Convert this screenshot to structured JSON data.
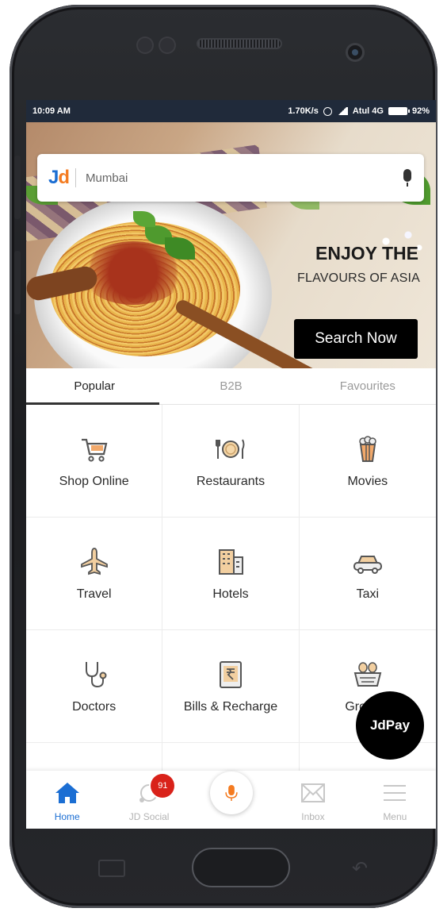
{
  "status_bar": {
    "time": "10:09 AM",
    "speed": "1.70K/s",
    "carrier": "Atul 4G",
    "battery": "92%"
  },
  "search": {
    "logo_j": "J",
    "logo_d": "d",
    "city": "Mumbai"
  },
  "banner": {
    "headline": "ENJOY THE",
    "subline": "FLAVOURS OF ASIA",
    "cta": "Search Now"
  },
  "tabs": [
    {
      "label": "Popular",
      "active": true
    },
    {
      "label": "B2B",
      "active": false
    },
    {
      "label": "Favourites",
      "active": false
    }
  ],
  "categories": [
    {
      "label": "Shop Online",
      "icon": "cart-icon"
    },
    {
      "label": "Restaurants",
      "icon": "plate-cutlery-icon"
    },
    {
      "label": "Movies",
      "icon": "popcorn-icon"
    },
    {
      "label": "Travel",
      "icon": "airplane-icon"
    },
    {
      "label": "Hotels",
      "icon": "building-icon"
    },
    {
      "label": "Taxi",
      "icon": "car-icon"
    },
    {
      "label": "Doctors",
      "icon": "stethoscope-icon"
    },
    {
      "label": "Bills & Recharge",
      "icon": "bill-rupee-icon"
    },
    {
      "label": "Grocery",
      "icon": "basket-icon"
    }
  ],
  "fab": {
    "label": "JdPay"
  },
  "bottom_nav": [
    {
      "label": "Home",
      "icon": "home-icon",
      "active": true
    },
    {
      "label": "JD Social",
      "icon": "social-icon",
      "badge": "91"
    },
    {
      "label": "",
      "icon": "mic-icon"
    },
    {
      "label": "Inbox",
      "icon": "envelope-icon"
    },
    {
      "label": "Menu",
      "icon": "hamburger-icon"
    }
  ],
  "colors": {
    "brand_blue": "#1b6ed3",
    "brand_orange": "#f47b20",
    "status_bar": "#202a3a",
    "badge_red": "#d9221a"
  }
}
